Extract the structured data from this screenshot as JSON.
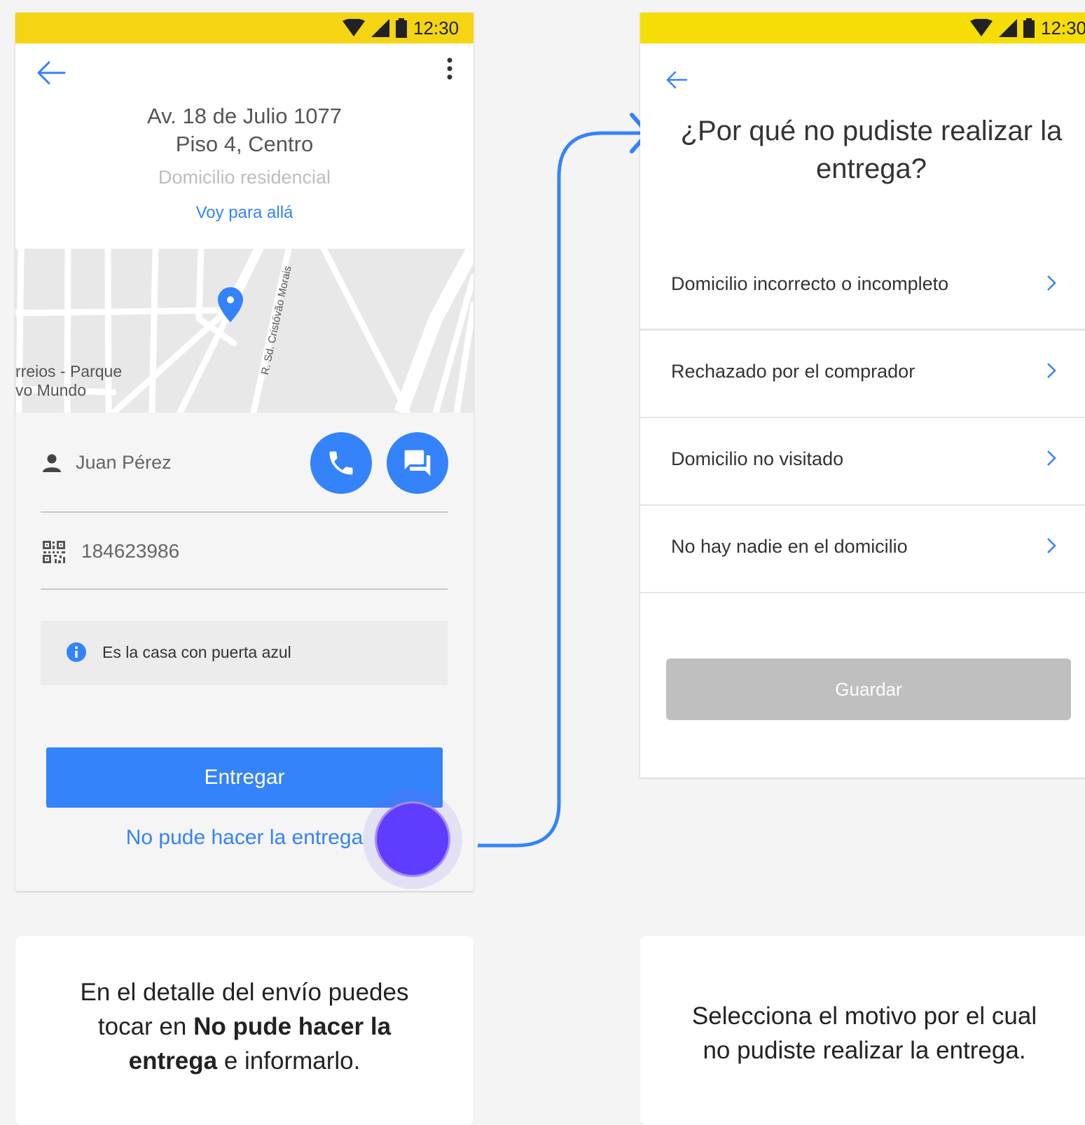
{
  "status_bar": {
    "time": "12:30"
  },
  "screen1": {
    "address_line1": "Av. 18 de Julio 1077",
    "address_line2": "Piso 4, Centro",
    "address_type": "Domicilio residencial",
    "navigate_link": "Voy para allá",
    "map": {
      "street_label": "R. Sd. Cristóvão Morais",
      "place_line1": "rreios - Parque",
      "place_line2": "vo Mundo"
    },
    "contact_name": "Juan Pérez",
    "shipment_id": "184623986",
    "note": "Es la casa con puerta azul",
    "deliver_button": "Entregar",
    "failed_link": "No pude hacer la entrega"
  },
  "screen2": {
    "title": "¿Por qué no pudiste realizar la entrega?",
    "options": [
      {
        "label": "Domicilio incorrecto o incompleto"
      },
      {
        "label": "Rechazado por el comprador"
      },
      {
        "label": "Domicilio no visitado"
      },
      {
        "label": "No hay nadie en el domicilio"
      }
    ],
    "save_button": "Guardar"
  },
  "captions": {
    "left_part1": "En el detalle del envío puedes tocar en ",
    "left_bold": "No pude hacer la entrega",
    "left_part2": " e informarlo.",
    "right": "Selecciona el motivo por el cual no pudiste realizar la entrega."
  },
  "colors": {
    "status_bar": "#f5d413",
    "primary": "#3483fa",
    "disabled_button": "#bfbfbf",
    "tap_indicator": "#5f3cff",
    "connector_arrow": "#3483fa"
  },
  "icons": [
    "wifi-icon",
    "signal-icon",
    "battery-icon",
    "back-arrow-icon",
    "more-vert-icon",
    "map-pin-icon",
    "person-icon",
    "phone-icon",
    "chat-icon",
    "qr-code-icon",
    "info-icon",
    "chevron-right-icon"
  ]
}
